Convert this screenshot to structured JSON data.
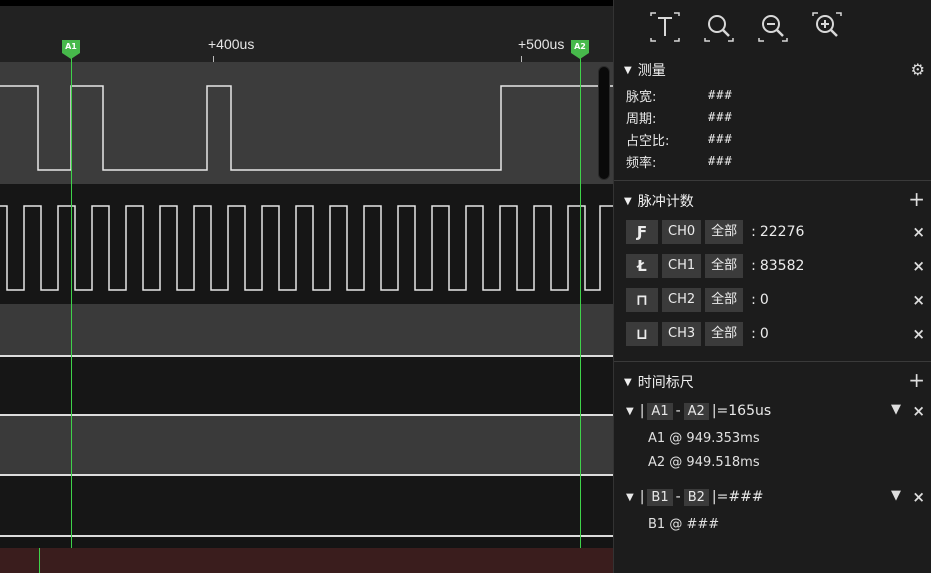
{
  "ruler": {
    "ticks": [
      "+400us",
      "+500us"
    ],
    "cursor_a1": "A1",
    "cursor_a2": "A2"
  },
  "toolbar": {
    "icons": [
      "text-cursor-icon",
      "search-fit-icon",
      "zoom-out-icon",
      "zoom-in-icon"
    ]
  },
  "measure": {
    "title": "测量",
    "rows": [
      {
        "label": "脉宽:",
        "value": "###"
      },
      {
        "label": "周期:",
        "value": "###"
      },
      {
        "label": "占空比:",
        "value": "###"
      },
      {
        "label": "频率:",
        "value": "###"
      }
    ]
  },
  "pulse_count": {
    "title": "脉冲计数",
    "add": "+",
    "rows": [
      {
        "edge": "rising-edge-icon",
        "glyph": "Ƒ",
        "channel": "CH0",
        "scope": "全部",
        "sep": ":",
        "count": "22276",
        "remove": "×"
      },
      {
        "edge": "falling-edge-icon",
        "glyph": "Ł",
        "channel": "CH1",
        "scope": "全部",
        "sep": ":",
        "count": "83582",
        "remove": "×"
      },
      {
        "edge": "positive-pulse-icon",
        "glyph": "⊓",
        "channel": "CH2",
        "scope": "全部",
        "sep": ":",
        "count": "0",
        "remove": "×"
      },
      {
        "edge": "negative-pulse-icon",
        "glyph": "⊔",
        "channel": "CH3",
        "scope": "全部",
        "sep": ":",
        "count": "0",
        "remove": "×"
      }
    ]
  },
  "time_ruler": {
    "title": "时间标尺",
    "add": "+",
    "rulers": [
      {
        "a": "A1",
        "b": "A2",
        "result": "=165us",
        "line1": "A1 @ 949.353ms",
        "line2": "A2 @ 949.518ms"
      },
      {
        "a": "B1",
        "b": "B2",
        "result": "=###",
        "line1": "B1 @ ###",
        "line2": ""
      }
    ]
  },
  "colors": {
    "cursor": "#3fd24a",
    "wave": "#e6e6e6",
    "band_dark": "#141414",
    "band_light": "#3c3c3c"
  }
}
